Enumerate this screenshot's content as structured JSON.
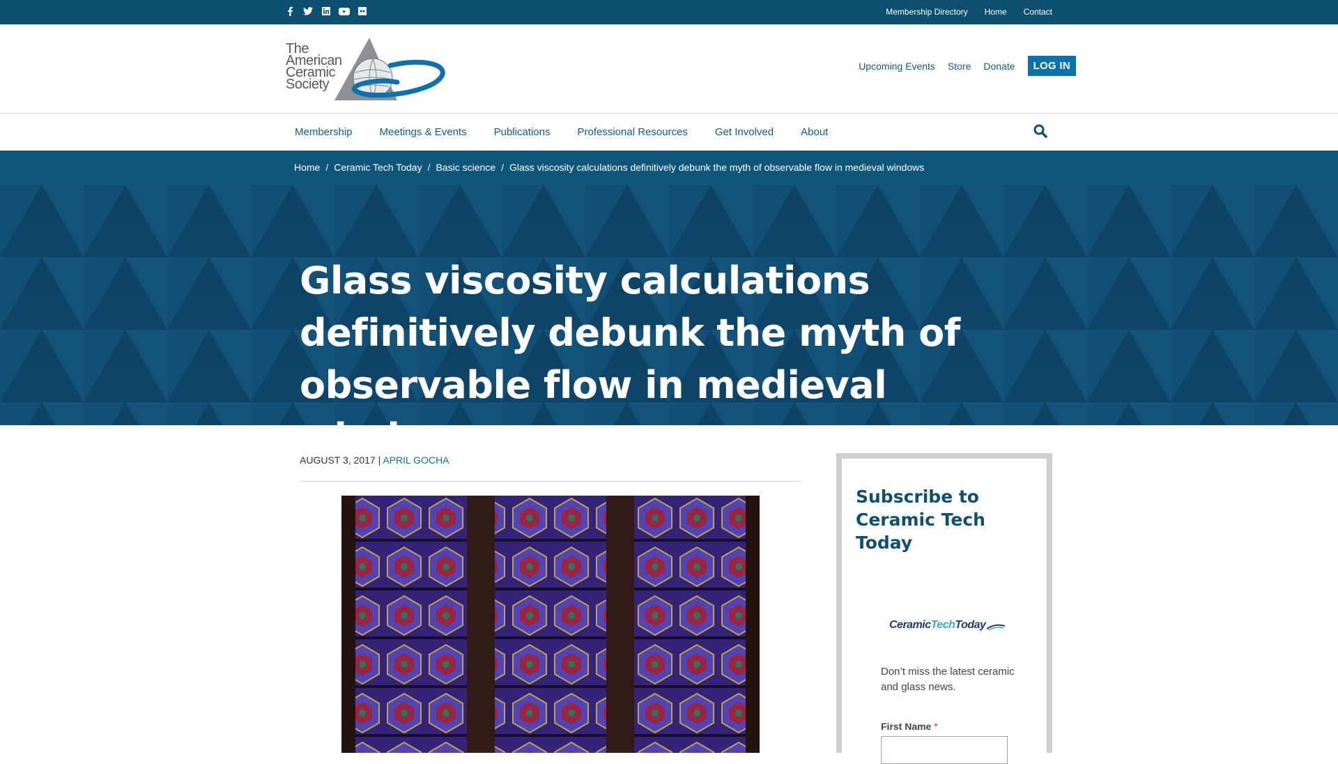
{
  "topbar": {
    "social": [
      {
        "name": "facebook-icon",
        "glyph": "f"
      },
      {
        "name": "twitter-icon",
        "glyph": "t"
      },
      {
        "name": "linkedin-icon",
        "glyph": "in"
      },
      {
        "name": "youtube-icon",
        "glyph": "▶"
      },
      {
        "name": "flickr-icon",
        "glyph": "••"
      }
    ],
    "links": [
      "Membership Directory",
      "Home",
      "Contact"
    ]
  },
  "header": {
    "logo_lines": [
      "The",
      "American",
      "Ceramic",
      "Society"
    ],
    "links": [
      "Upcoming Events",
      "Store",
      "Donate"
    ],
    "login_label": "LOG IN"
  },
  "nav": {
    "items": [
      "Membership",
      "Meetings & Events",
      "Publications",
      "Professional Resources",
      "Get Involved",
      "About"
    ]
  },
  "breadcrumb": {
    "items": [
      "Home",
      "Ceramic Tech Today",
      "Basic science",
      "Glass viscosity calculations definitively debunk the myth of observable flow in medieval windows"
    ],
    "separator": "/"
  },
  "hero": {
    "title": "Glass viscosity calculations definitively debunk the myth of observable flow in medieval windows"
  },
  "article": {
    "date": "AUGUST 3, 2017",
    "meta_separator": " | ",
    "author": "APRIL GOCHA"
  },
  "sidebar": {
    "title": "Subscribe to Ceramic Tech Today",
    "logo_text_1": "Ceramic",
    "logo_text_2": "Tech",
    "logo_text_3": "Today",
    "description": "Don’t miss the latest ceramic and glass news.",
    "first_name_label": "First Name",
    "required_mark": "*"
  },
  "colors": {
    "brand_dark": "#0c4f6f",
    "brand_blue": "#0c72ad",
    "hero_bg": "#0f4a6e"
  }
}
